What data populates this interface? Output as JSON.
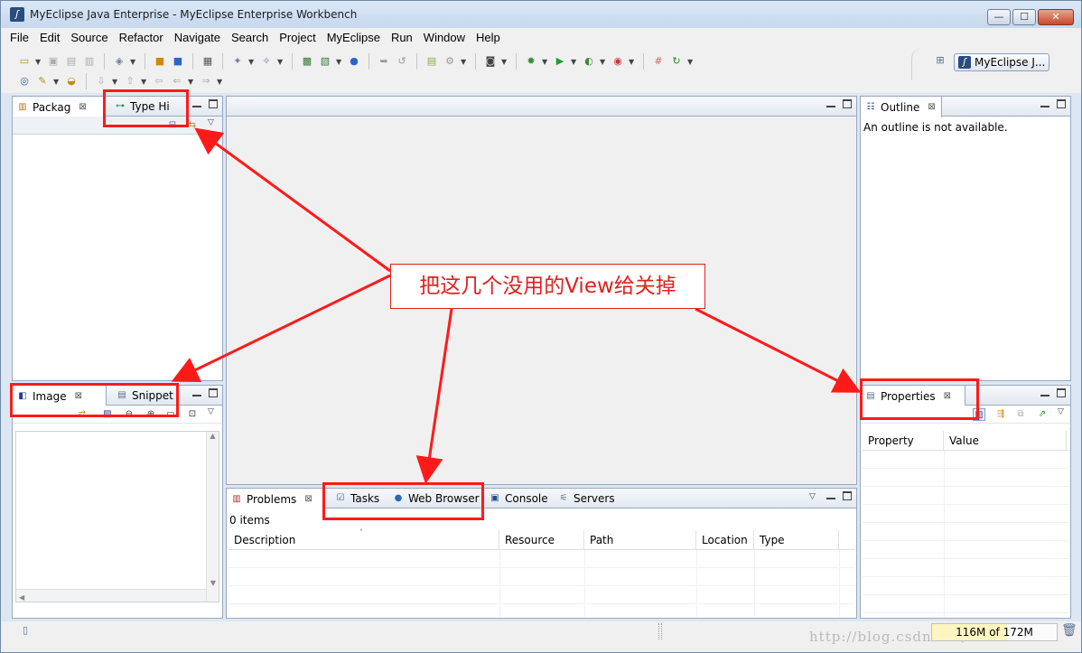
{
  "window": {
    "title": "MyEclipse Java Enterprise - MyEclipse Enterprise Workbench",
    "controls": {
      "minimize": "—",
      "maximize": "☐",
      "close": "✕"
    }
  },
  "menu": [
    "File",
    "Edit",
    "Source",
    "Refactor",
    "Navigate",
    "Search",
    "Project",
    "MyEclipse",
    "Run",
    "Window",
    "Help"
  ],
  "perspective": {
    "label": "MyEclipse J..."
  },
  "left_top_view": {
    "tabs": [
      {
        "label": "Packag",
        "close": "⊠"
      },
      {
        "label": "Type Hi"
      }
    ]
  },
  "left_bottom_view": {
    "tabs": [
      {
        "label": "Image",
        "close": "⊠"
      },
      {
        "label": "Snippet"
      }
    ]
  },
  "outline_view": {
    "tab": {
      "label": "Outline",
      "close": "⊠"
    },
    "message": "An outline is not available."
  },
  "properties_view": {
    "tab": {
      "label": "Properties",
      "close": "⊠"
    },
    "columns": [
      "Property",
      "Value"
    ]
  },
  "bottom_view": {
    "tabs": [
      {
        "label": "Problems",
        "close": "⊠"
      },
      {
        "label": "Tasks"
      },
      {
        "label": "Web Browser"
      },
      {
        "label": "Console"
      },
      {
        "label": "Servers"
      }
    ],
    "item_count": "0 items",
    "columns": [
      "Description",
      "Resource",
      "Path",
      "Location",
      "Type"
    ]
  },
  "status": {
    "heap": "116M of 172M",
    "watermark": "http://blog.csdn.net/tenfufe"
  },
  "annotation": {
    "callout": "把这几个没用的View给关掉",
    "color": "#ff1a1a"
  },
  "icons": {
    "view_close": "close-icon",
    "view_minimize": "minimize-icon",
    "view_maximize": "maximize-icon",
    "trash": "trash-icon"
  }
}
